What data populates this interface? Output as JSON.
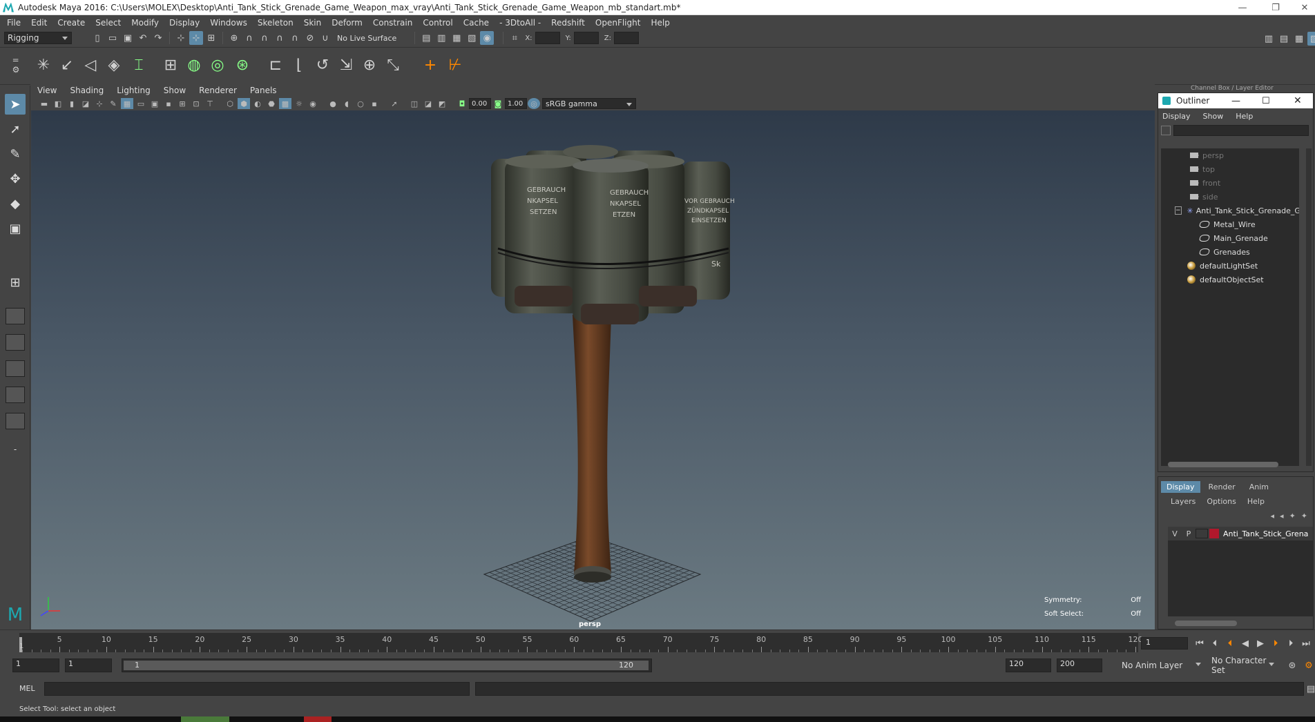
{
  "window": {
    "title": "Autodesk Maya 2016: C:\\Users\\MOLEX\\Desktop\\Anti_Tank_Stick_Grenade_Game_Weapon_max_vray\\Anti_Tank_Stick_Grenade_Game_Weapon_mb_standart.mb*"
  },
  "menus": [
    "File",
    "Edit",
    "Create",
    "Select",
    "Modify",
    "Display",
    "Windows",
    "Skeleton",
    "Skin",
    "Deform",
    "Constrain",
    "Control",
    "Cache",
    "- 3DtoAll -",
    "Redshift",
    "OpenFlight",
    "Help"
  ],
  "status": {
    "mode": "Rigging",
    "live_surface": "No Live Surface",
    "x_label": "X:",
    "y_label": "Y:",
    "z_label": "Z:"
  },
  "panel": {
    "menus": [
      "View",
      "Shading",
      "Lighting",
      "Show",
      "Renderer",
      "Panels"
    ],
    "exposure": "0.00",
    "gamma": "1.00",
    "colorspace": "sRGB gamma",
    "camera_label": "persp",
    "hud": {
      "symmetry_label": "Symmetry:",
      "symmetry_value": "Off",
      "soft_select_label": "Soft Select:",
      "soft_select_value": "Off"
    }
  },
  "channel_box_title": "Channel Box / Layer Editor",
  "outliner": {
    "title": "Outliner",
    "menus": [
      "Display",
      "Show",
      "Help"
    ],
    "items": [
      "persp",
      "top",
      "front",
      "side",
      "Anti_Tank_Stick_Grenade_Ga",
      "Metal_Wire",
      "Main_Grenade",
      "Grenades",
      "defaultLightSet",
      "defaultObjectSet"
    ]
  },
  "layer_editor": {
    "tabs": [
      "Display",
      "Render",
      "Anim"
    ],
    "menus": [
      "Layers",
      "Options",
      "Help"
    ],
    "layer": {
      "v": "V",
      "p": "P",
      "name": "Anti_Tank_Stick_Grena",
      "color": "#b0182c"
    }
  },
  "timeline": {
    "labels": [
      "5",
      "10",
      "15",
      "20",
      "25",
      "30",
      "35",
      "40",
      "45",
      "50",
      "55",
      "60",
      "65",
      "70",
      "75",
      "80",
      "85",
      "90",
      "95",
      "100",
      "105",
      "110",
      "115",
      "120"
    ],
    "current_frame_start": "1",
    "current_frame_field": "1"
  },
  "range": {
    "start": "1",
    "anim_start": "1",
    "slider_start": "1",
    "slider_end": "120",
    "anim_end": "120",
    "end": "200",
    "anim_layer": "No Anim Layer",
    "character_set": "No Character Set"
  },
  "cmd": {
    "label": "MEL"
  },
  "help_line": "Select Tool: select an object",
  "colors": {
    "accent": "#5d8aa8",
    "bg": "#444444",
    "field": "#2b2b2b"
  }
}
